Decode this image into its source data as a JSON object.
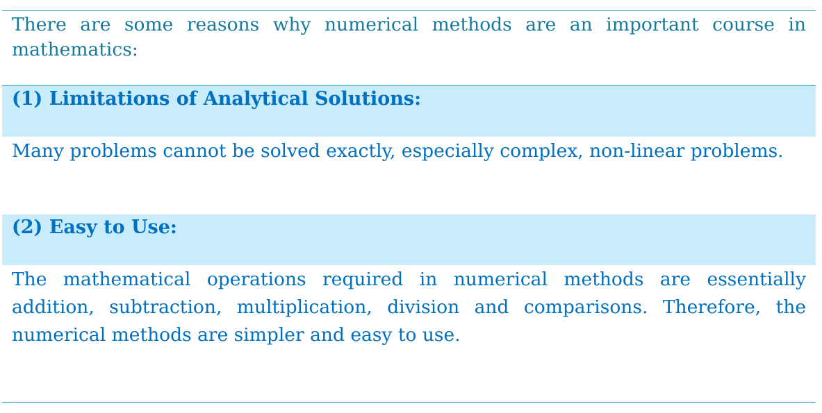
{
  "intro": "There are some reasons why numerical methods are an important course in mathematics:",
  "sections": [
    {
      "heading": "(1) Limitations of Analytical Solutions:",
      "body": "Many problems cannot be solved exactly, especially complex, non-linear problems."
    },
    {
      "heading": "(2) Easy to Use:",
      "body": "The mathematical operations required in numerical methods are essentially addition, subtraction, multiplication, division and comparisons. Therefore, the numerical methods are simpler and easy to use."
    }
  ],
  "colors": {
    "intro_text": "#17799b",
    "body_text": "#0070c0",
    "heading_text": "#0070c0",
    "heading_background": "#c9ecfa",
    "rule": "#2a9fd0"
  }
}
